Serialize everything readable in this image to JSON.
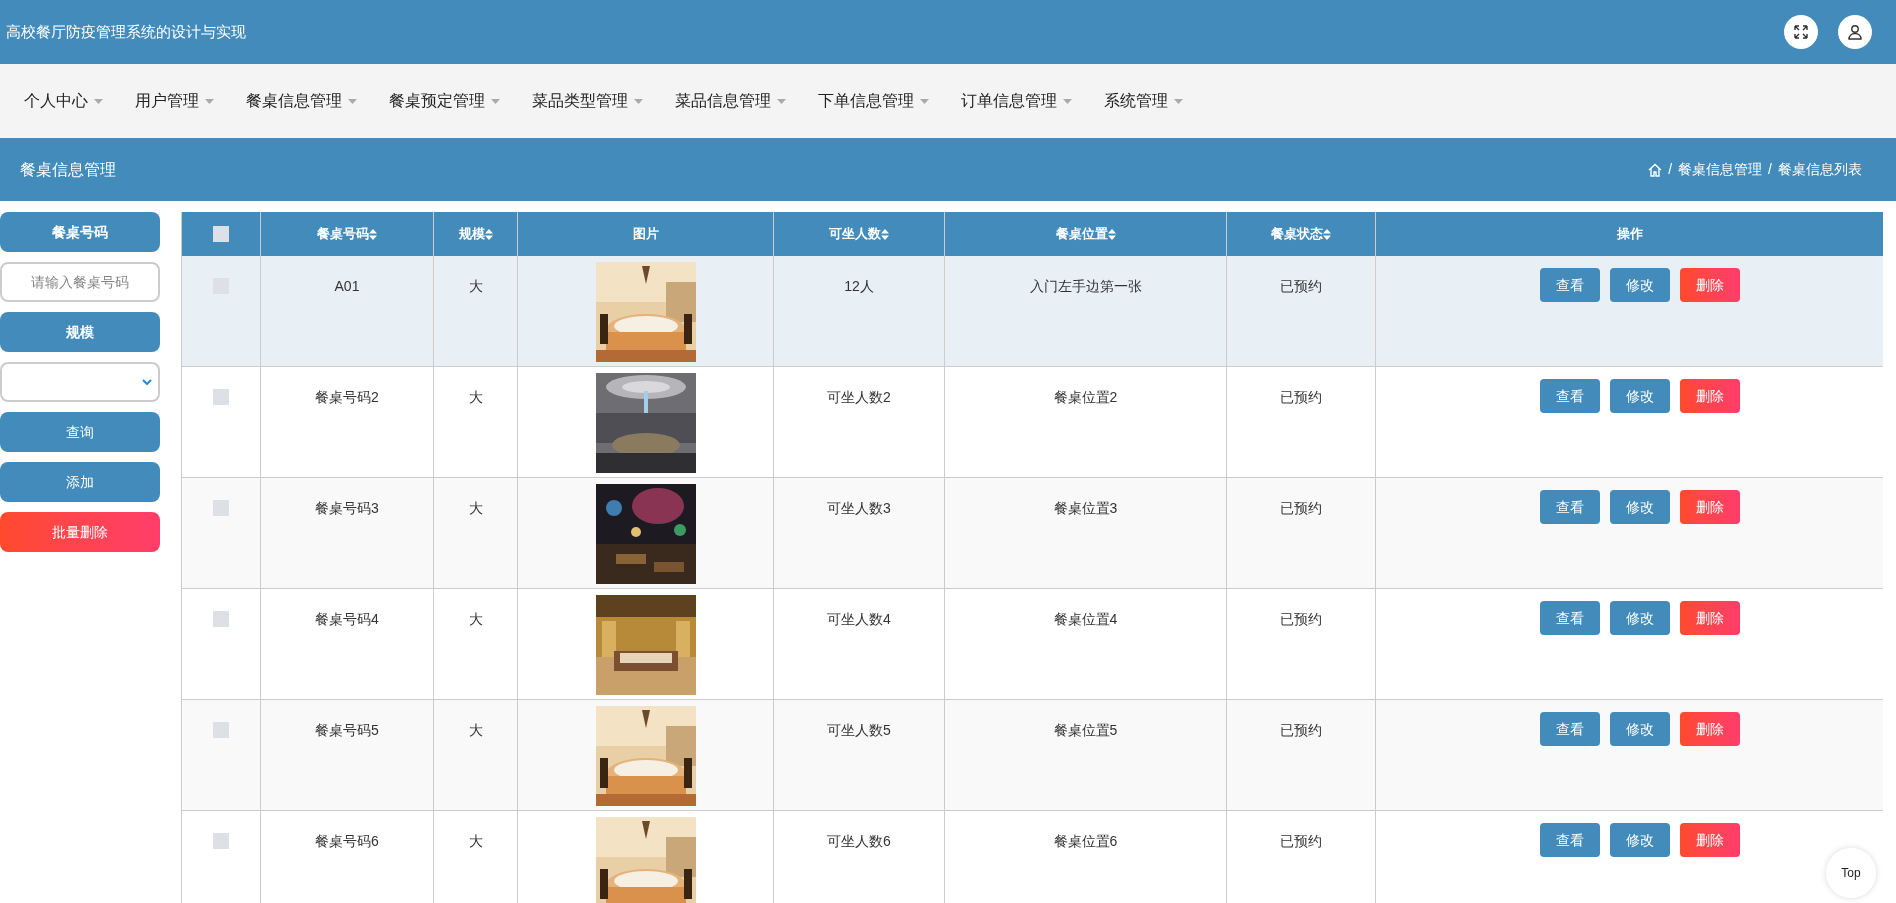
{
  "header": {
    "title": "高校餐厅防疫管理系统的设计与实现"
  },
  "nav": [
    {
      "label": "个人中心"
    },
    {
      "label": "用户管理"
    },
    {
      "label": "餐桌信息管理"
    },
    {
      "label": "餐桌预定管理"
    },
    {
      "label": "菜品类型管理"
    },
    {
      "label": "菜品信息管理"
    },
    {
      "label": "下单信息管理"
    },
    {
      "label": "订单信息管理"
    },
    {
      "label": "系统管理"
    }
  ],
  "page_title": "餐桌信息管理",
  "breadcrumb": {
    "separator": "/",
    "items": [
      "餐桌信息管理",
      "餐桌信息列表"
    ]
  },
  "filters": [
    {
      "kind": "label",
      "text": "餐桌号码"
    },
    {
      "kind": "input",
      "placeholder": "请输入餐桌号码"
    },
    {
      "kind": "label",
      "text": "规模"
    },
    {
      "kind": "select"
    },
    {
      "kind": "button",
      "text": "查询"
    },
    {
      "kind": "button",
      "text": "添加"
    },
    {
      "kind": "danger",
      "text": "批量删除"
    }
  ],
  "table": {
    "select_all": false,
    "columns": [
      {
        "label": "餐桌号码",
        "sortable": true
      },
      {
        "label": "规模",
        "sortable": true
      },
      {
        "label": "图片",
        "sortable": false
      },
      {
        "label": "可坐人数",
        "sortable": true
      },
      {
        "label": "餐桌位置",
        "sortable": true
      },
      {
        "label": "餐桌状态",
        "sortable": true
      },
      {
        "label": "操作",
        "sortable": false
      }
    ],
    "rows": [
      {
        "checked": false,
        "highlighted": true,
        "cells": [
          "A01",
          "大",
          {
            "kind": "picture"
          },
          "12人",
          "入门左手边第一张",
          "已预约"
        ],
        "actions": [
          {
            "label": "查看",
            "kind": "primary"
          },
          {
            "label": "修改",
            "kind": "primary"
          },
          {
            "label": "删除",
            "kind": "danger"
          }
        ]
      },
      {
        "checked": false,
        "highlighted": false,
        "cells": [
          "餐桌号码2",
          "大",
          {
            "kind": "picture"
          },
          "可坐人数2",
          "餐桌位置2",
          "已预约"
        ],
        "actions": [
          {
            "label": "查看",
            "kind": "primary"
          },
          {
            "label": "修改",
            "kind": "primary"
          },
          {
            "label": "删除",
            "kind": "danger"
          }
        ]
      },
      {
        "checked": false,
        "highlighted": false,
        "cells": [
          "餐桌号码3",
          "大",
          {
            "kind": "picture"
          },
          "可坐人数3",
          "餐桌位置3",
          "已预约"
        ],
        "actions": [
          {
            "label": "查看",
            "kind": "primary"
          },
          {
            "label": "修改",
            "kind": "primary"
          },
          {
            "label": "删除",
            "kind": "danger"
          }
        ]
      },
      {
        "checked": false,
        "highlighted": false,
        "cells": [
          "餐桌号码4",
          "大",
          {
            "kind": "picture"
          },
          "可坐人数4",
          "餐桌位置4",
          "已预约"
        ],
        "actions": [
          {
            "label": "查看",
            "kind": "primary"
          },
          {
            "label": "修改",
            "kind": "primary"
          },
          {
            "label": "删除",
            "kind": "danger"
          }
        ]
      },
      {
        "checked": false,
        "highlighted": false,
        "cells": [
          "餐桌号码5",
          "大",
          {
            "kind": "picture"
          },
          "可坐人数5",
          "餐桌位置5",
          "已预约"
        ],
        "actions": [
          {
            "label": "查看",
            "kind": "primary"
          },
          {
            "label": "修改",
            "kind": "primary"
          },
          {
            "label": "删除",
            "kind": "danger"
          }
        ]
      },
      {
        "checked": false,
        "highlighted": false,
        "cells": [
          "餐桌号码6",
          "大",
          {
            "kind": "picture"
          },
          "可坐人数6",
          "餐桌位置6",
          "已预约"
        ],
        "actions": [
          {
            "label": "查看",
            "kind": "primary"
          },
          {
            "label": "修改",
            "kind": "primary"
          },
          {
            "label": "删除",
            "kind": "danger"
          }
        ]
      }
    ]
  },
  "back_to_top": "Top"
}
